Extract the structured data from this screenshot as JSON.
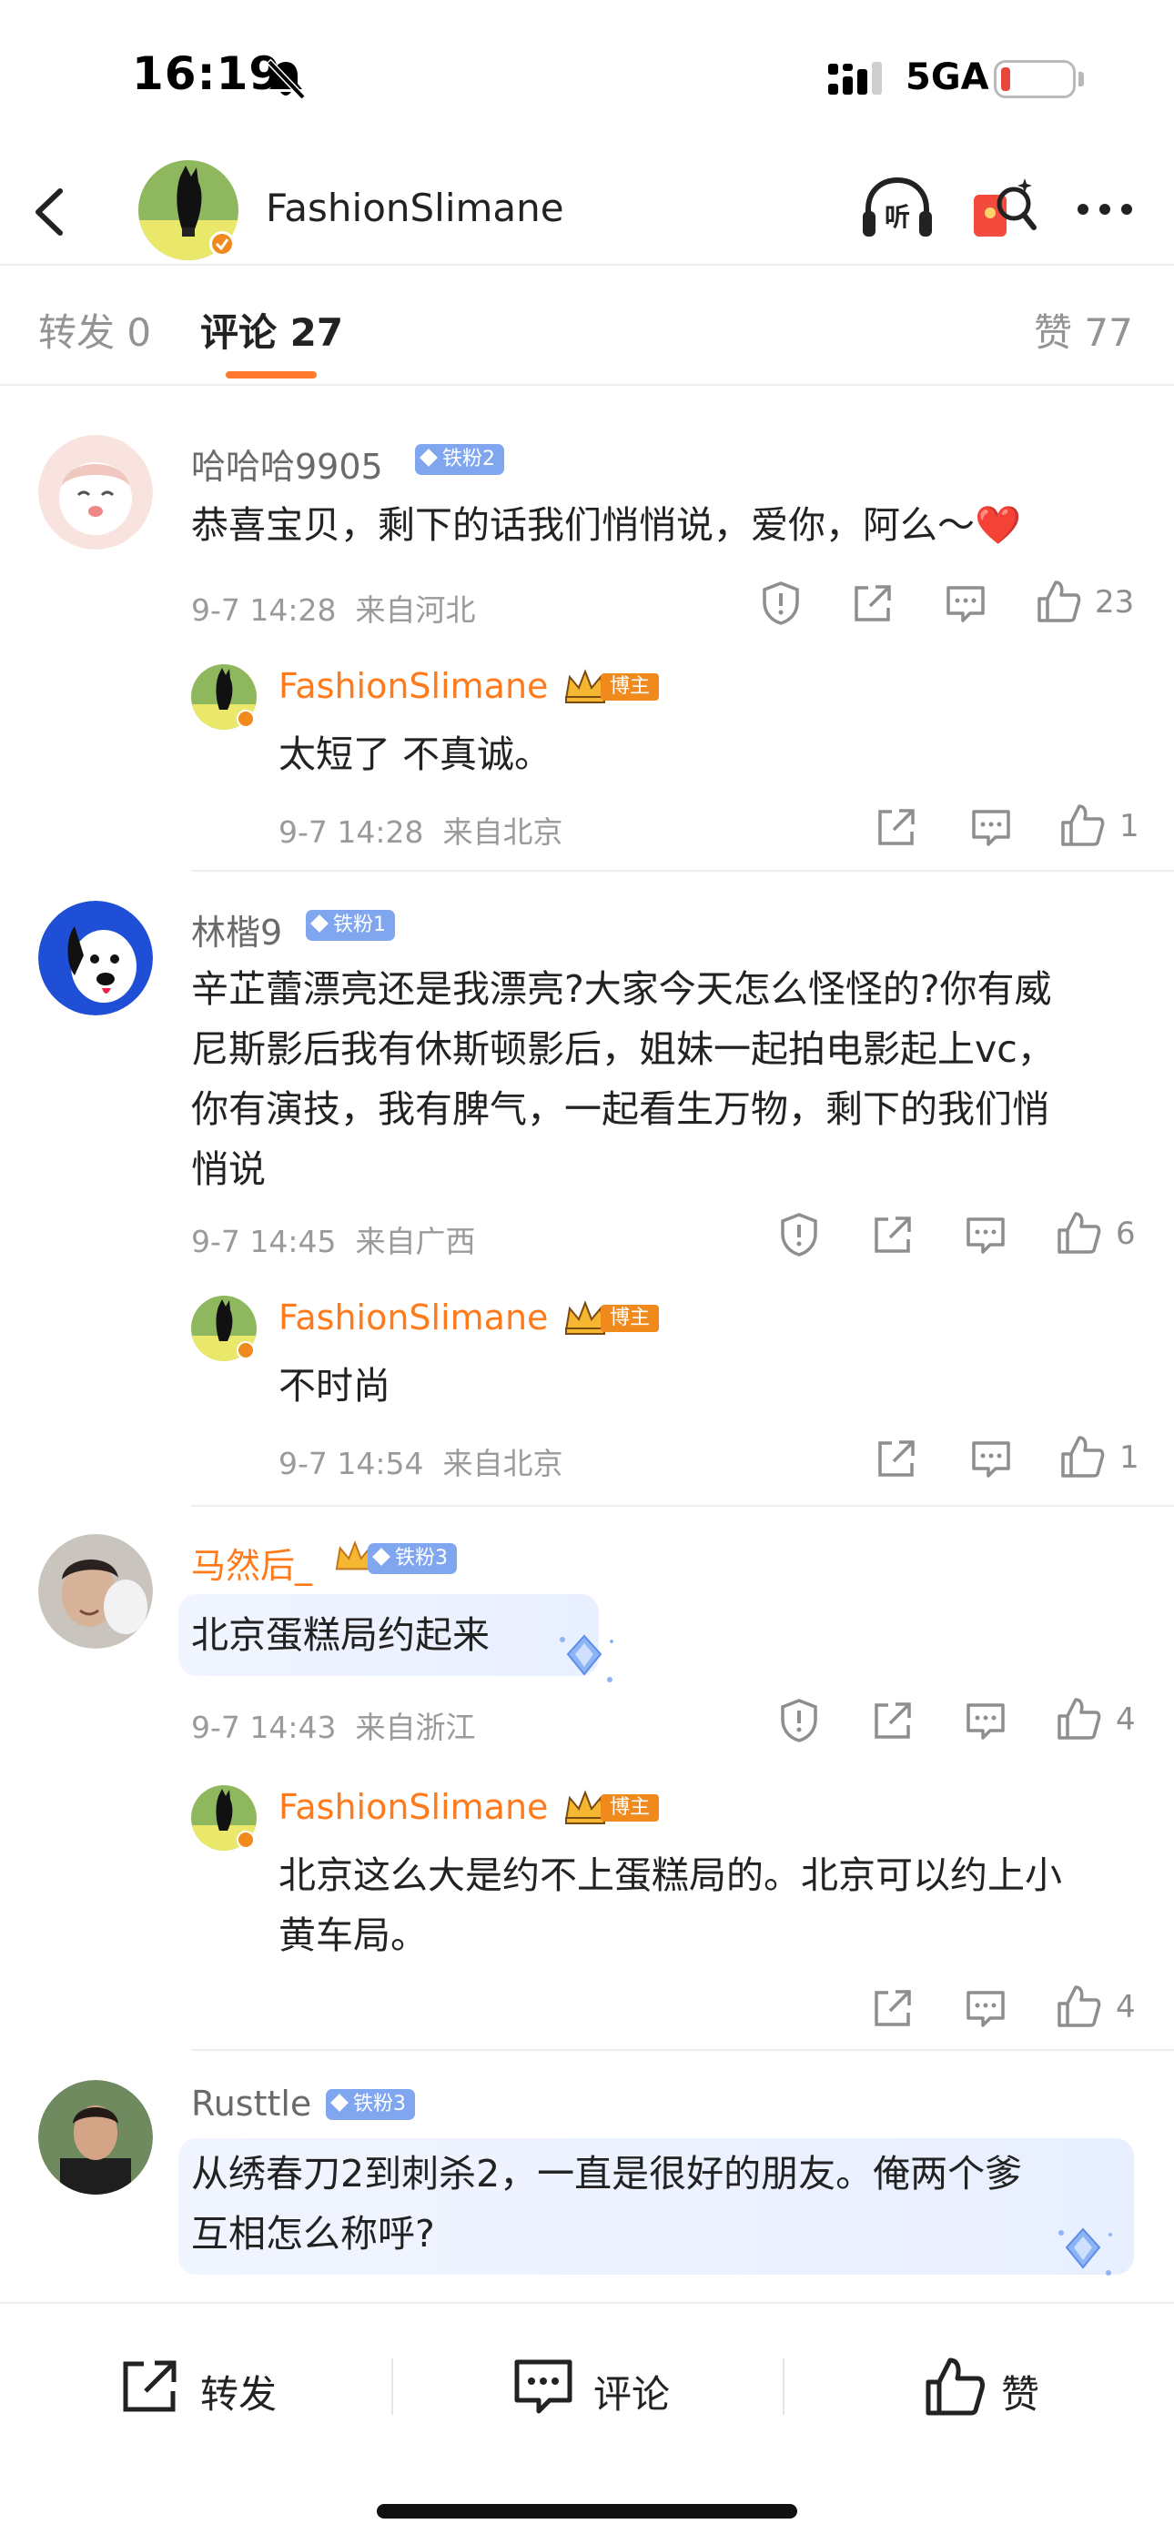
{
  "status_bar": {
    "time": "16:19",
    "network": "5GA",
    "battery_color": "#e8453c"
  },
  "nav": {
    "title": "FashionSlimane"
  },
  "tabs": {
    "repost": "转发 0",
    "comment": "评论 27",
    "like": "赞 77",
    "active_color": "#ff7a2e"
  },
  "comments": [
    {
      "user": "哈哈哈9905",
      "badge": "铁粉2",
      "text": "恭喜宝贝，剩下的话我们悄悄说，爱你，阿么～❤️",
      "time": "9-7 14:28",
      "location": "来自河北",
      "likes": "23",
      "reply": {
        "user": "FashionSlimane",
        "badge": "博主",
        "text": "太短了 不真诚。",
        "time": "9-7 14:28",
        "location": "来自北京",
        "likes": "1"
      }
    },
    {
      "user": "林楷9",
      "badge": "铁粉1",
      "text_lines": [
        "辛芷蕾漂亮还是我漂亮?大家今天怎么怪怪的?你有威",
        "尼斯影后我有休斯顿影后，姐妹一起拍电影起上vc，",
        "你有演技，我有脾气，一起看生万物，剩下的我们悄",
        "悄说"
      ],
      "time": "9-7 14:45",
      "location": "来自广西",
      "likes": "6",
      "reply": {
        "user": "FashionSlimane",
        "badge": "博主",
        "text": "不时尚",
        "time": "9-7 14:54",
        "location": "来自北京",
        "likes": "1"
      }
    },
    {
      "user": "马然后_",
      "badge": "铁粉3",
      "text": "北京蛋糕局约起来",
      "time": "9-7 14:43",
      "location": "来自浙江",
      "likes": "4",
      "reply": {
        "user": "FashionSlimane",
        "badge": "博主",
        "text_lines": [
          "北京这么大是约不上蛋糕局的。北京可以约上小",
          "黄车局。"
        ],
        "likes": "4"
      }
    },
    {
      "user": "Rusttle",
      "badge": "铁粉3",
      "text_lines": [
        "从绣春刀2到刺杀2，一直是很好的朋友。俺两个爹",
        "互相怎么称呼?"
      ]
    }
  ],
  "bottom_bar": {
    "repost": "转发",
    "comment": "评论",
    "like": "赞"
  },
  "icons": [
    "bell-off-icon",
    "signal-icon",
    "back-icon",
    "listen-icon",
    "red-packet-icon",
    "more-icon",
    "report-icon",
    "share-icon",
    "comment-icon",
    "like-icon"
  ]
}
